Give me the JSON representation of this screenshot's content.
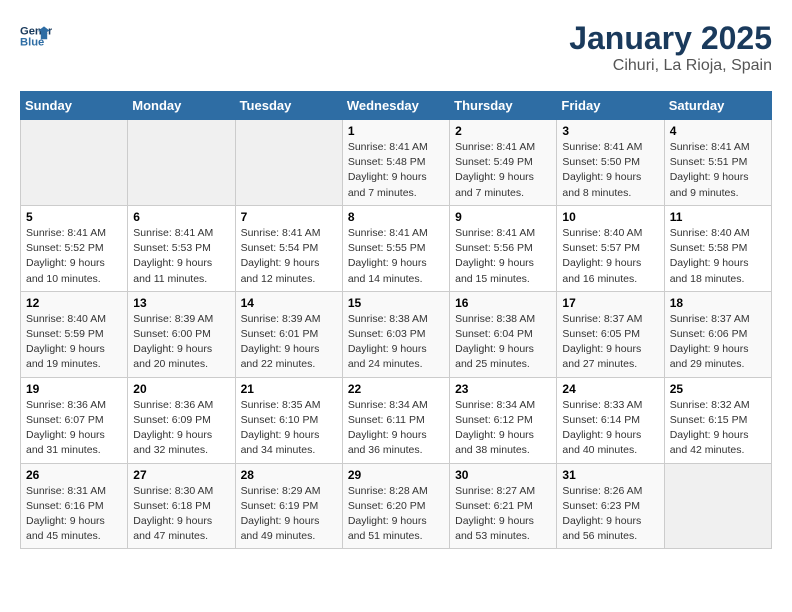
{
  "logo": {
    "line1": "General",
    "line2": "Blue"
  },
  "title": "January 2025",
  "subtitle": "Cihuri, La Rioja, Spain",
  "days_of_week": [
    "Sunday",
    "Monday",
    "Tuesday",
    "Wednesday",
    "Thursday",
    "Friday",
    "Saturday"
  ],
  "weeks": [
    [
      {
        "num": "",
        "info": ""
      },
      {
        "num": "",
        "info": ""
      },
      {
        "num": "",
        "info": ""
      },
      {
        "num": "1",
        "info": "Sunrise: 8:41 AM\nSunset: 5:48 PM\nDaylight: 9 hours\nand 7 minutes."
      },
      {
        "num": "2",
        "info": "Sunrise: 8:41 AM\nSunset: 5:49 PM\nDaylight: 9 hours\nand 7 minutes."
      },
      {
        "num": "3",
        "info": "Sunrise: 8:41 AM\nSunset: 5:50 PM\nDaylight: 9 hours\nand 8 minutes."
      },
      {
        "num": "4",
        "info": "Sunrise: 8:41 AM\nSunset: 5:51 PM\nDaylight: 9 hours\nand 9 minutes."
      }
    ],
    [
      {
        "num": "5",
        "info": "Sunrise: 8:41 AM\nSunset: 5:52 PM\nDaylight: 9 hours\nand 10 minutes."
      },
      {
        "num": "6",
        "info": "Sunrise: 8:41 AM\nSunset: 5:53 PM\nDaylight: 9 hours\nand 11 minutes."
      },
      {
        "num": "7",
        "info": "Sunrise: 8:41 AM\nSunset: 5:54 PM\nDaylight: 9 hours\nand 12 minutes."
      },
      {
        "num": "8",
        "info": "Sunrise: 8:41 AM\nSunset: 5:55 PM\nDaylight: 9 hours\nand 14 minutes."
      },
      {
        "num": "9",
        "info": "Sunrise: 8:41 AM\nSunset: 5:56 PM\nDaylight: 9 hours\nand 15 minutes."
      },
      {
        "num": "10",
        "info": "Sunrise: 8:40 AM\nSunset: 5:57 PM\nDaylight: 9 hours\nand 16 minutes."
      },
      {
        "num": "11",
        "info": "Sunrise: 8:40 AM\nSunset: 5:58 PM\nDaylight: 9 hours\nand 18 minutes."
      }
    ],
    [
      {
        "num": "12",
        "info": "Sunrise: 8:40 AM\nSunset: 5:59 PM\nDaylight: 9 hours\nand 19 minutes."
      },
      {
        "num": "13",
        "info": "Sunrise: 8:39 AM\nSunset: 6:00 PM\nDaylight: 9 hours\nand 20 minutes."
      },
      {
        "num": "14",
        "info": "Sunrise: 8:39 AM\nSunset: 6:01 PM\nDaylight: 9 hours\nand 22 minutes."
      },
      {
        "num": "15",
        "info": "Sunrise: 8:38 AM\nSunset: 6:03 PM\nDaylight: 9 hours\nand 24 minutes."
      },
      {
        "num": "16",
        "info": "Sunrise: 8:38 AM\nSunset: 6:04 PM\nDaylight: 9 hours\nand 25 minutes."
      },
      {
        "num": "17",
        "info": "Sunrise: 8:37 AM\nSunset: 6:05 PM\nDaylight: 9 hours\nand 27 minutes."
      },
      {
        "num": "18",
        "info": "Sunrise: 8:37 AM\nSunset: 6:06 PM\nDaylight: 9 hours\nand 29 minutes."
      }
    ],
    [
      {
        "num": "19",
        "info": "Sunrise: 8:36 AM\nSunset: 6:07 PM\nDaylight: 9 hours\nand 31 minutes."
      },
      {
        "num": "20",
        "info": "Sunrise: 8:36 AM\nSunset: 6:09 PM\nDaylight: 9 hours\nand 32 minutes."
      },
      {
        "num": "21",
        "info": "Sunrise: 8:35 AM\nSunset: 6:10 PM\nDaylight: 9 hours\nand 34 minutes."
      },
      {
        "num": "22",
        "info": "Sunrise: 8:34 AM\nSunset: 6:11 PM\nDaylight: 9 hours\nand 36 minutes."
      },
      {
        "num": "23",
        "info": "Sunrise: 8:34 AM\nSunset: 6:12 PM\nDaylight: 9 hours\nand 38 minutes."
      },
      {
        "num": "24",
        "info": "Sunrise: 8:33 AM\nSunset: 6:14 PM\nDaylight: 9 hours\nand 40 minutes."
      },
      {
        "num": "25",
        "info": "Sunrise: 8:32 AM\nSunset: 6:15 PM\nDaylight: 9 hours\nand 42 minutes."
      }
    ],
    [
      {
        "num": "26",
        "info": "Sunrise: 8:31 AM\nSunset: 6:16 PM\nDaylight: 9 hours\nand 45 minutes."
      },
      {
        "num": "27",
        "info": "Sunrise: 8:30 AM\nSunset: 6:18 PM\nDaylight: 9 hours\nand 47 minutes."
      },
      {
        "num": "28",
        "info": "Sunrise: 8:29 AM\nSunset: 6:19 PM\nDaylight: 9 hours\nand 49 minutes."
      },
      {
        "num": "29",
        "info": "Sunrise: 8:28 AM\nSunset: 6:20 PM\nDaylight: 9 hours\nand 51 minutes."
      },
      {
        "num": "30",
        "info": "Sunrise: 8:27 AM\nSunset: 6:21 PM\nDaylight: 9 hours\nand 53 minutes."
      },
      {
        "num": "31",
        "info": "Sunrise: 8:26 AM\nSunset: 6:23 PM\nDaylight: 9 hours\nand 56 minutes."
      },
      {
        "num": "",
        "info": ""
      }
    ]
  ]
}
